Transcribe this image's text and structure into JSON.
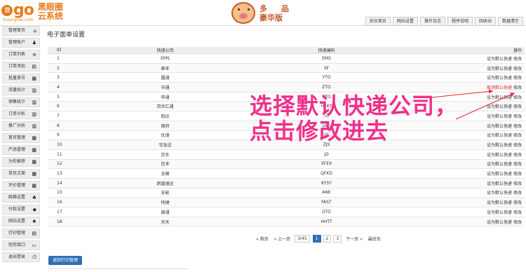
{
  "header": {
    "logo_mark": "go",
    "logo_circle": "双",
    "logo_domain": "huangow.com",
    "logo_line1": "黑眼圈",
    "logo_line2": "云系统",
    "brand_line1": "多 品",
    "brand_line2": "豪华版",
    "nav": [
      "后台首页",
      "网站设置",
      "操作日志",
      "程序说明",
      "回收站",
      "数据清空"
    ]
  },
  "sidebar": {
    "items": [
      {
        "label": "管理首页",
        "icon": "home-icon",
        "glyph": "⌂"
      },
      {
        "label": "管理账户",
        "icon": "user-icon",
        "glyph": "♟"
      },
      {
        "label": "订单列表",
        "icon": "list-icon",
        "glyph": "≡"
      },
      {
        "label": "订单添加",
        "icon": "file-icon",
        "glyph": "▤"
      },
      {
        "label": "批量单号",
        "icon": "stack-icon",
        "glyph": "▦"
      },
      {
        "label": "流量统计",
        "icon": "signal-icon",
        "glyph": "▥"
      },
      {
        "label": "销售统计",
        "icon": "chart-icon",
        "glyph": "▥"
      },
      {
        "label": "订单分析",
        "icon": "bars-icon",
        "glyph": "▥"
      },
      {
        "label": "推广分析",
        "icon": "bars-icon",
        "glyph": "▥"
      },
      {
        "label": "首页管理",
        "icon": "grid-icon",
        "glyph": "▦"
      },
      {
        "label": "产品管理",
        "icon": "grid-icon",
        "glyph": "▦"
      },
      {
        "label": "为你推荐",
        "icon": "grid-icon",
        "glyph": "▦"
      },
      {
        "label": "单页文案",
        "icon": "grid-icon",
        "glyph": "▦"
      },
      {
        "label": "评价管理",
        "icon": "grid-icon",
        "glyph": "▦"
      },
      {
        "label": "邮箱设置",
        "icon": "bell-icon",
        "glyph": "♣"
      },
      {
        "label": "付款设置",
        "icon": "tag-icon",
        "glyph": "◆"
      },
      {
        "label": "网站设置",
        "icon": "spade-icon",
        "glyph": "♠"
      },
      {
        "label": "打印管理",
        "icon": "print-icon",
        "glyph": "▤"
      },
      {
        "label": "短信接口",
        "icon": "chat-icon",
        "glyph": "▭"
      },
      {
        "label": "退出登录",
        "icon": "power-icon",
        "glyph": "⏻"
      }
    ]
  },
  "main": {
    "title": "电子面单设置",
    "columns": {
      "id": "ID",
      "name": "快递公司",
      "code": "快递编码",
      "ops": "操作"
    },
    "rows": [
      {
        "id": "1",
        "name": "EMS",
        "code": "EMS",
        "set": "设为默认快递",
        "edit": "修改"
      },
      {
        "id": "2",
        "name": "顺丰",
        "code": "SF",
        "set": "设为默认快递",
        "edit": "修改"
      },
      {
        "id": "3",
        "name": "圆通",
        "code": "YTO",
        "set": "设为默认快递",
        "edit": "修改"
      },
      {
        "id": "4",
        "name": "中通",
        "code": "ZTO",
        "set": "取消默认快递",
        "edit": "修改",
        "is_default": true
      },
      {
        "id": "5",
        "name": "申通",
        "code": "STO",
        "set": "设为默认快递",
        "edit": "修改"
      },
      {
        "id": "6",
        "name": "百世汇通",
        "code": "HTKY",
        "set": "设为默认快递",
        "edit": "修改"
      },
      {
        "id": "7",
        "name": "韵达",
        "code": "YD",
        "set": "设为默认快递",
        "edit": "修改"
      },
      {
        "id": "8",
        "name": "德邦",
        "code": "DBL",
        "set": "设为默认快递",
        "edit": "修改"
      },
      {
        "id": "9",
        "name": "优速",
        "code": "UC",
        "set": "设为默认快递",
        "edit": "修改"
      },
      {
        "id": "10",
        "name": "宅急送",
        "code": "ZJS",
        "set": "设为默认快递",
        "edit": "修改"
      },
      {
        "id": "11",
        "name": "京东",
        "code": "JD",
        "set": "设为默认快递",
        "edit": "修改"
      },
      {
        "id": "12",
        "name": "信丰",
        "code": "XFEX",
        "set": "设为默认快递",
        "edit": "修改"
      },
      {
        "id": "13",
        "name": "全峰",
        "code": "QFKD",
        "set": "设为默认快递",
        "edit": "修改"
      },
      {
        "id": "14",
        "name": "跨越速运",
        "code": "KYSY",
        "set": "设为默认快递",
        "edit": "修改"
      },
      {
        "id": "15",
        "name": "安能",
        "code": "ANE",
        "set": "设为默认快递",
        "edit": "修改"
      },
      {
        "id": "16",
        "name": "快捷",
        "code": "FAST",
        "set": "设为默认快递",
        "edit": "修改"
      },
      {
        "id": "17",
        "name": "国通",
        "code": "GTO",
        "set": "设为默认快递",
        "edit": "修改"
      },
      {
        "id": "18",
        "name": "天天",
        "code": "HHTT",
        "set": "设为默认快递",
        "edit": "修改"
      }
    ],
    "pager": {
      "first": "« 首页",
      "prev": "« 上一页",
      "info": "3/45",
      "pages": [
        "1",
        "2",
        "3"
      ],
      "active": "1",
      "next": "下一页 »",
      "last": "最后页"
    },
    "back_button": "返回打印管理"
  },
  "annotation": {
    "line1": "选择默认快递公司，",
    "line2": "点击修改进去",
    "color": "#f0308a"
  }
}
